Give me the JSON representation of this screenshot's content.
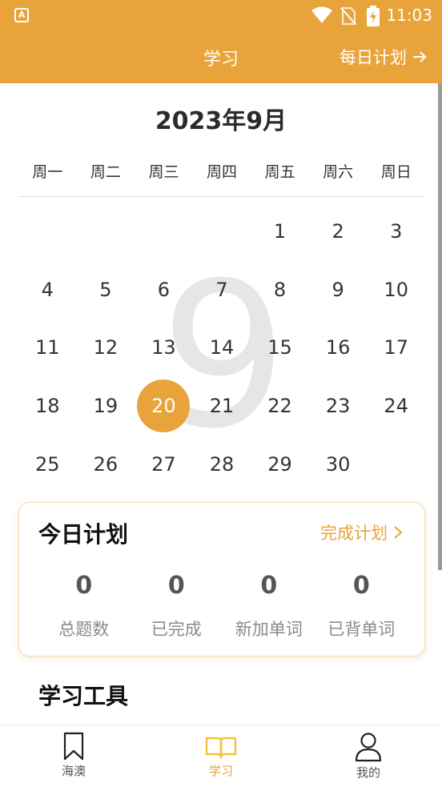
{
  "status_bar": {
    "time": "11:03",
    "app_badge": "A"
  },
  "app_bar": {
    "title": "学习",
    "daily_plan": "每日计划"
  },
  "calendar": {
    "month_title": "2023年9月",
    "watermark": "9",
    "weekdays": [
      "周一",
      "周二",
      "周三",
      "周四",
      "周五",
      "周六",
      "周日"
    ],
    "leading_blanks": 4,
    "days": [
      "1",
      "2",
      "3",
      "4",
      "5",
      "6",
      "7",
      "8",
      "9",
      "10",
      "11",
      "12",
      "13",
      "14",
      "15",
      "16",
      "17",
      "18",
      "19",
      "20",
      "21",
      "22",
      "23",
      "24",
      "25",
      "26",
      "27",
      "28",
      "29",
      "30"
    ],
    "selected_day": "20"
  },
  "plan_card": {
    "title": "今日计划",
    "complete_label": "完成计划",
    "stats": [
      {
        "value": "0",
        "label": "总题数"
      },
      {
        "value": "0",
        "label": "已完成"
      },
      {
        "value": "0",
        "label": "新加单词"
      },
      {
        "value": "0",
        "label": "已背单词"
      }
    ]
  },
  "tools": {
    "title": "学习工具"
  },
  "bottom_nav": {
    "items": [
      {
        "label": "海澳",
        "icon": "bookmark-icon",
        "active": false
      },
      {
        "label": "学习",
        "icon": "open-book-icon",
        "active": true
      },
      {
        "label": "我的",
        "icon": "person-icon",
        "active": false
      }
    ]
  },
  "colors": {
    "accent": "#e8a43a",
    "active_nav": "#e8a43a"
  }
}
